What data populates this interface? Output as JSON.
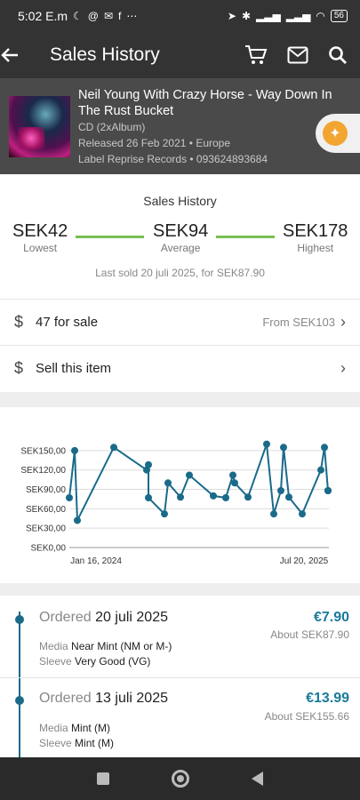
{
  "status": {
    "time": "5:02 E.m",
    "battery": "56"
  },
  "app_bar": {
    "title": "Sales History"
  },
  "release": {
    "title": "Neil Young With Crazy Horse - Way Down In The Rust Bucket",
    "format": "CD (2xAlbum)",
    "released": "Released 26 Feb 2021",
    "country": "• Europe",
    "label": "Label Reprise Records • 093624893684"
  },
  "sales_history": {
    "heading": "Sales History",
    "lowest_value": "SEK42",
    "lowest_label": "Lowest",
    "average_value": "SEK94",
    "average_label": "Average",
    "highest_value": "SEK178",
    "highest_label": "Highest",
    "last_sold": "Last sold 20 juli 2025, for SEK87.90"
  },
  "for_sale": {
    "icon": "dollar-icon",
    "label": "47 for sale",
    "from": "From SEK103"
  },
  "sell": {
    "icon": "dollar-icon",
    "label": "Sell this item"
  },
  "chart_data": {
    "type": "line",
    "y_ticks": [
      "SEK0,00",
      "SEK30,00",
      "SEK60,00",
      "SEK90,00",
      "SEK120,00",
      "SEK150,00"
    ],
    "x_tick_labels": [
      "Jan 16, 2024",
      "Jul 20, 2025"
    ],
    "ylim": [
      0,
      165
    ],
    "x_index": [
      0,
      1,
      2,
      3,
      4,
      5,
      6,
      7,
      8,
      9,
      10,
      11,
      12,
      13,
      14,
      15,
      16,
      17,
      18,
      19,
      20,
      21,
      22,
      23,
      24,
      25,
      26
    ],
    "values": [
      77,
      150,
      42,
      155,
      120,
      128,
      77,
      52,
      100,
      78,
      112,
      80,
      77,
      112,
      100,
      78,
      160,
      52,
      88,
      155,
      78,
      52,
      120,
      155,
      88,
      88,
      88
    ],
    "line_color": "#1a6a8a",
    "grid": true
  },
  "orders": [
    {
      "label": "Ordered",
      "date": "20 juli 2025",
      "price": "€7.90",
      "about": "About SEK87.90",
      "media_key": "Media",
      "media_val": "Near Mint (NM or M-)",
      "sleeve_key": "Sleeve",
      "sleeve_val": "Very Good (VG)"
    },
    {
      "label": "Ordered",
      "date": "13 juli 2025",
      "price": "€13.99",
      "about": "About SEK155.66",
      "media_key": "Media",
      "media_val": "Mint (M)",
      "sleeve_key": "Sleeve",
      "sleeve_val": "Mint (M)"
    }
  ]
}
